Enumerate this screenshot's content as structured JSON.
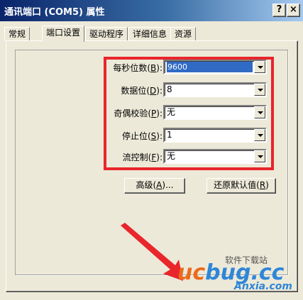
{
  "window": {
    "title": "通讯端口 (COM5) 属性",
    "help_glyph": "?",
    "close_glyph": "×"
  },
  "tabs": [
    {
      "label": "常规",
      "active": false
    },
    {
      "label": "端口设置",
      "active": true
    },
    {
      "label": "驱动程序",
      "active": false
    },
    {
      "label": "详细信息",
      "active": false
    },
    {
      "label": "资源",
      "active": false
    }
  ],
  "settings": [
    {
      "label": "每秒位数",
      "key": "B",
      "value": "9600"
    },
    {
      "label": "数据位",
      "key": "D",
      "value": "8"
    },
    {
      "label": "奇偶校验",
      "key": "P",
      "value": "无"
    },
    {
      "label": "停止位",
      "key": "S",
      "value": "1"
    },
    {
      "label": "流控制",
      "key": "F",
      "value": "无"
    }
  ],
  "buttons": {
    "advanced": {
      "label": "高级",
      "key": "A",
      "suffix": "..."
    },
    "restore": {
      "label": "还原默认值",
      "key": "R",
      "suffix": ""
    }
  },
  "watermark": {
    "brand_uc": "uc",
    "brand_rest": "bug.cc",
    "chinese": "软件下载站",
    "site": "Anxia.com"
  },
  "colors": {
    "highlight_border": "#e8262b",
    "title_gradient_start": "#0a246a",
    "selection": "#316ac5",
    "watermark_orange": "#ec6a1c",
    "watermark_blue": "#2f86d8"
  }
}
